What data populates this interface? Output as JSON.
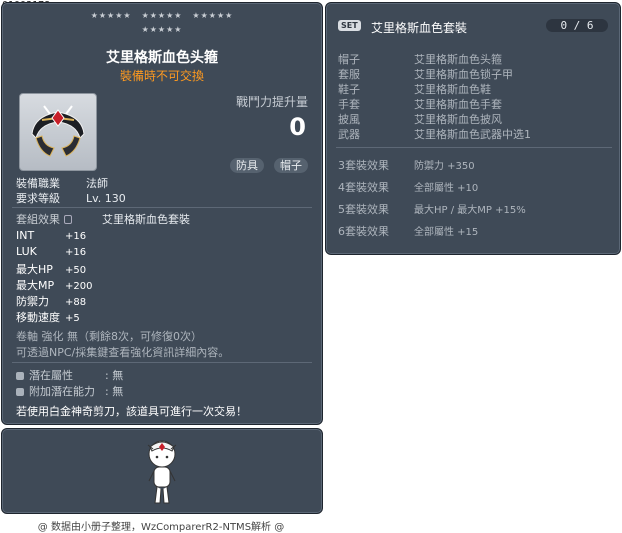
{
  "item_id": "01003178",
  "item": {
    "name": "艾里格斯血色头箍",
    "trade_note": "裝備時不可交換",
    "icon": "helmet-icon",
    "atk_label": "戰鬥力提升量",
    "atk_value": "0",
    "tags": [
      "防具",
      "帽子"
    ],
    "requirements": [
      {
        "label": "裝備職業",
        "value": "法師"
      },
      {
        "label": "要求等級",
        "value": "Lv. 130"
      }
    ],
    "set_effect_label": "套組效果",
    "set_effect_value": "艾里格斯血色套裝",
    "stats": [
      {
        "label": "INT",
        "value": "+16"
      },
      {
        "label": "LUK",
        "value": "+16"
      },
      {
        "label": "最大HP",
        "value": "+50"
      },
      {
        "label": "最大MP",
        "value": "+200"
      },
      {
        "label": "防禦力",
        "value": "+88"
      },
      {
        "label": "移動速度",
        "value": "+5"
      }
    ],
    "upgrade_note": "卷軸 強化 無（剩餘8次，可修復0次）",
    "enhance_note": "可透過NPC/採集鍵查看強化資訊詳細內容。",
    "potentials": [
      {
        "label": "潛在屬性",
        "value": ":  無"
      },
      {
        "label": "附加潛在能力",
        "value": ":  無"
      }
    ],
    "scissors_note": "若使用白金神奇剪刀，該道具可進行一次交易！"
  },
  "set": {
    "badge": "SET",
    "title": "艾里格斯血色套裝",
    "count": "0 / 6",
    "pieces": [
      {
        "slot": "帽子",
        "name": "艾里格斯血色头箍"
      },
      {
        "slot": "套服",
        "name": "艾里格斯血色锁子甲"
      },
      {
        "slot": "鞋子",
        "name": "艾里格斯血色鞋"
      },
      {
        "slot": "手套",
        "name": "艾里格斯血色手套"
      },
      {
        "slot": "披風",
        "name": "艾里格斯血色披风"
      },
      {
        "slot": "武器",
        "name": "艾里格斯血色武器中选1"
      }
    ],
    "effects": [
      {
        "label": "3套裝效果",
        "text": "防禦力  +350"
      },
      {
        "label": "4套裝效果",
        "text": "全部屬性  +10"
      },
      {
        "label": "5套裝效果",
        "text": "最大HP / 最大MP  +15%"
      },
      {
        "label": "6套裝效果",
        "text": "全部屬性  +15"
      }
    ]
  },
  "preview": {
    "avatar": "character-avatar"
  },
  "footer": "@ 数据由小册子整理，WzComparerR2-NTMS解析 @"
}
